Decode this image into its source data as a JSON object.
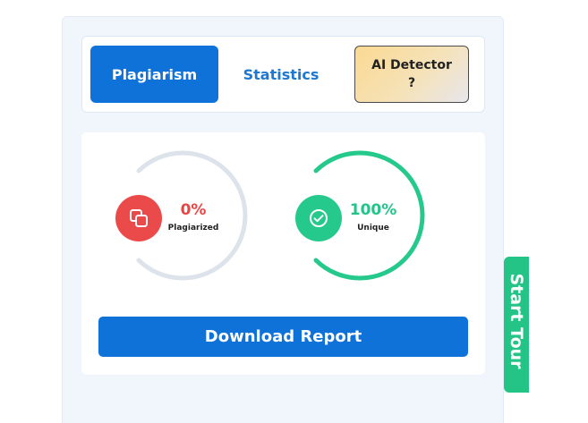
{
  "tabs": {
    "plagiarism": "Plagiarism",
    "statistics": "Statistics",
    "ai_detector_line1": "AI Detector",
    "ai_detector_line2": "?"
  },
  "results": {
    "plagiarized": {
      "percent": "0%",
      "label": "Plagiarized",
      "value": 0,
      "color": "#ea4a4a",
      "icon": "copy-icon"
    },
    "unique": {
      "percent": "100%",
      "label": "Unique",
      "value": 100,
      "color": "#26c98c",
      "icon": "check-circle-icon"
    }
  },
  "download_button": "Download Report",
  "tour_tab": "Start Tour",
  "colors": {
    "primary": "#0f72d8",
    "ring_track": "#dde3eb",
    "tour": "#23c486"
  }
}
